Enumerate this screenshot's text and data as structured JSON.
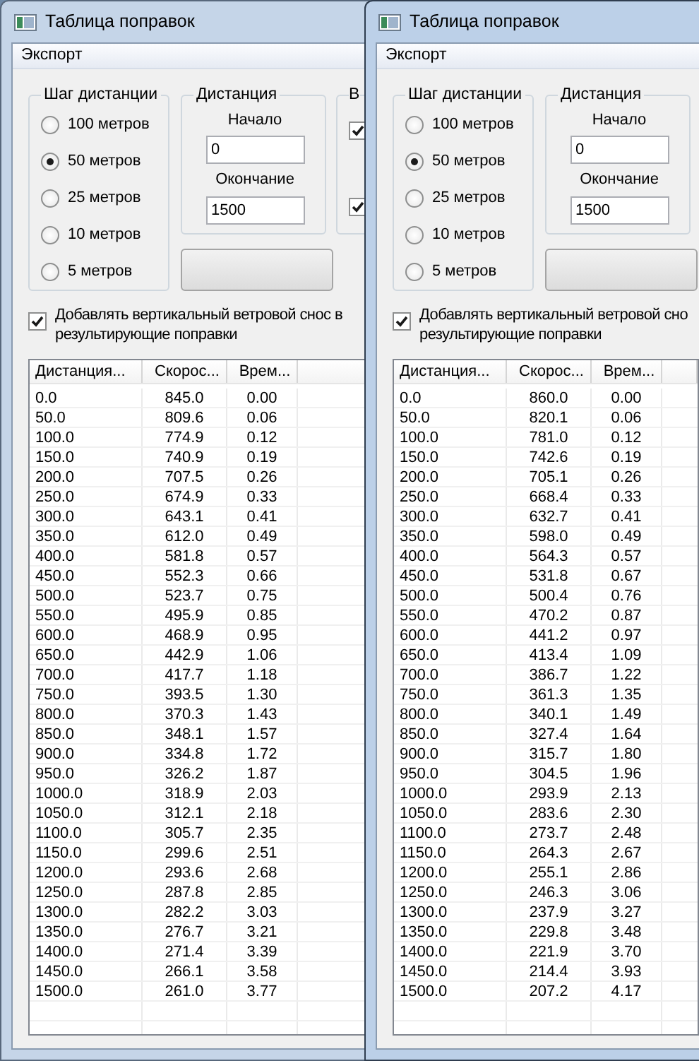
{
  "windows": [
    {
      "title": "Таблица поправок",
      "active": false,
      "menu": [
        "Экспорт"
      ],
      "step_group": {
        "title": "Шаг дистанции",
        "options": [
          {
            "label": "100 метров",
            "selected": false
          },
          {
            "label": "50 метров",
            "selected": true
          },
          {
            "label": "25 метров",
            "selected": false
          },
          {
            "label": "10 метров",
            "selected": false
          },
          {
            "label": "5 метров",
            "selected": false
          }
        ]
      },
      "distance_group": {
        "title": "Дистанция",
        "start_label": "Начало",
        "start_value": "0",
        "end_label": "Окончание",
        "end_value": "1500"
      },
      "group_3": {
        "title": "В",
        "checkboxes": [
          {
            "checked": true
          },
          {
            "checked": true
          }
        ]
      },
      "wind_checkbox": {
        "label_lines": [
          "Добавлять вертикальный ветровой снос в",
          "результирующие поправки"
        ],
        "checked": true
      },
      "table": {
        "columns": [
          "Дистанция...",
          "Скорос...",
          "Врем..."
        ],
        "rows": [
          [
            "0.0",
            "845.0",
            "0.00"
          ],
          [
            "50.0",
            "809.6",
            "0.06"
          ],
          [
            "100.0",
            "774.9",
            "0.12"
          ],
          [
            "150.0",
            "740.9",
            "0.19"
          ],
          [
            "200.0",
            "707.5",
            "0.26"
          ],
          [
            "250.0",
            "674.9",
            "0.33"
          ],
          [
            "300.0",
            "643.1",
            "0.41"
          ],
          [
            "350.0",
            "612.0",
            "0.49"
          ],
          [
            "400.0",
            "581.8",
            "0.57"
          ],
          [
            "450.0",
            "552.3",
            "0.66"
          ],
          [
            "500.0",
            "523.7",
            "0.75"
          ],
          [
            "550.0",
            "495.9",
            "0.85"
          ],
          [
            "600.0",
            "468.9",
            "0.95"
          ],
          [
            "650.0",
            "442.9",
            "1.06"
          ],
          [
            "700.0",
            "417.7",
            "1.18"
          ],
          [
            "750.0",
            "393.5",
            "1.30"
          ],
          [
            "800.0",
            "370.3",
            "1.43"
          ],
          [
            "850.0",
            "348.1",
            "1.57"
          ],
          [
            "900.0",
            "334.8",
            "1.72"
          ],
          [
            "950.0",
            "326.2",
            "1.87"
          ],
          [
            "1000.0",
            "318.9",
            "2.03"
          ],
          [
            "1050.0",
            "312.1",
            "2.18"
          ],
          [
            "1100.0",
            "305.7",
            "2.35"
          ],
          [
            "1150.0",
            "299.6",
            "2.51"
          ],
          [
            "1200.0",
            "293.6",
            "2.68"
          ],
          [
            "1250.0",
            "287.8",
            "2.85"
          ],
          [
            "1300.0",
            "282.2",
            "3.03"
          ],
          [
            "1350.0",
            "276.7",
            "3.21"
          ],
          [
            "1400.0",
            "271.4",
            "3.39"
          ],
          [
            "1450.0",
            "266.1",
            "3.58"
          ],
          [
            "1500.0",
            "261.0",
            "3.77"
          ]
        ]
      }
    },
    {
      "title": "Таблица поправок",
      "active": true,
      "menu": [
        "Экспорт"
      ],
      "step_group": {
        "title": "Шаг дистанции",
        "options": [
          {
            "label": "100 метров",
            "selected": false
          },
          {
            "label": "50 метров",
            "selected": true
          },
          {
            "label": "25 метров",
            "selected": false
          },
          {
            "label": "10 метров",
            "selected": false
          },
          {
            "label": "5 метров",
            "selected": false
          }
        ]
      },
      "distance_group": {
        "title": "Дистанция",
        "start_label": "Начало",
        "start_value": "0",
        "end_label": "Окончание",
        "end_value": "1500"
      },
      "wind_checkbox": {
        "label_lines": [
          "Добавлять вертикальный ветровой сно",
          "результирующие поправки"
        ],
        "checked": true
      },
      "table": {
        "columns": [
          "Дистанция...",
          "Скорос...",
          "Врем..."
        ],
        "rows": [
          [
            "0.0",
            "860.0",
            "0.00"
          ],
          [
            "50.0",
            "820.1",
            "0.06"
          ],
          [
            "100.0",
            "781.0",
            "0.12"
          ],
          [
            "150.0",
            "742.6",
            "0.19"
          ],
          [
            "200.0",
            "705.1",
            "0.26"
          ],
          [
            "250.0",
            "668.4",
            "0.33"
          ],
          [
            "300.0",
            "632.7",
            "0.41"
          ],
          [
            "350.0",
            "598.0",
            "0.49"
          ],
          [
            "400.0",
            "564.3",
            "0.57"
          ],
          [
            "450.0",
            "531.8",
            "0.67"
          ],
          [
            "500.0",
            "500.4",
            "0.76"
          ],
          [
            "550.0",
            "470.2",
            "0.87"
          ],
          [
            "600.0",
            "441.2",
            "0.97"
          ],
          [
            "650.0",
            "413.4",
            "1.09"
          ],
          [
            "700.0",
            "386.7",
            "1.22"
          ],
          [
            "750.0",
            "361.3",
            "1.35"
          ],
          [
            "800.0",
            "340.1",
            "1.49"
          ],
          [
            "850.0",
            "327.4",
            "1.64"
          ],
          [
            "900.0",
            "315.7",
            "1.80"
          ],
          [
            "950.0",
            "304.5",
            "1.96"
          ],
          [
            "1000.0",
            "293.9",
            "2.13"
          ],
          [
            "1050.0",
            "283.6",
            "2.30"
          ],
          [
            "1100.0",
            "273.7",
            "2.48"
          ],
          [
            "1150.0",
            "264.3",
            "2.67"
          ],
          [
            "1200.0",
            "255.1",
            "2.86"
          ],
          [
            "1250.0",
            "246.3",
            "3.06"
          ],
          [
            "1300.0",
            "237.9",
            "3.27"
          ],
          [
            "1350.0",
            "229.8",
            "3.48"
          ],
          [
            "1400.0",
            "221.9",
            "3.70"
          ],
          [
            "1450.0",
            "214.4",
            "3.93"
          ],
          [
            "1500.0",
            "207.2",
            "4.17"
          ]
        ]
      }
    }
  ]
}
